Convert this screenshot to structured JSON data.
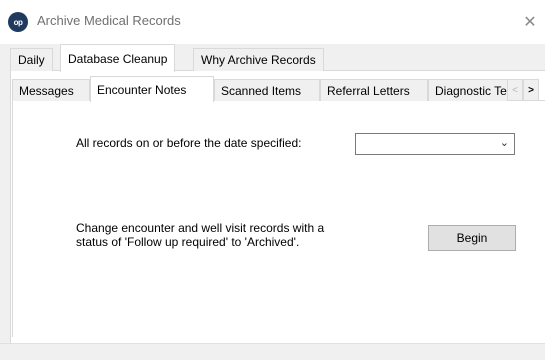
{
  "window": {
    "title": "Archive Medical Records",
    "app_icon_text": "op",
    "close_glyph": "✕"
  },
  "top_tabs": [
    {
      "label": "Daily",
      "active": false
    },
    {
      "label": "Database Cleanup",
      "active": true
    },
    {
      "label": "Why Archive Records",
      "active": false
    }
  ],
  "inner_tabs": [
    {
      "label": "Messages",
      "active": false
    },
    {
      "label": "Encounter Notes",
      "active": true
    },
    {
      "label": "Scanned Items",
      "active": false
    },
    {
      "label": "Referral Letters",
      "active": false
    },
    {
      "label": "Diagnostic Te",
      "active": false
    }
  ],
  "scroll": {
    "left_glyph": "<",
    "right_glyph": ">"
  },
  "form": {
    "date_label": "All records on or before the date specified:",
    "date_value": "",
    "chevron_glyph": "⌄",
    "info_line1": "Change encounter and well visit records with a",
    "info_line2": "status of 'Follow up required' to 'Archived'.",
    "begin_label": "Begin"
  }
}
